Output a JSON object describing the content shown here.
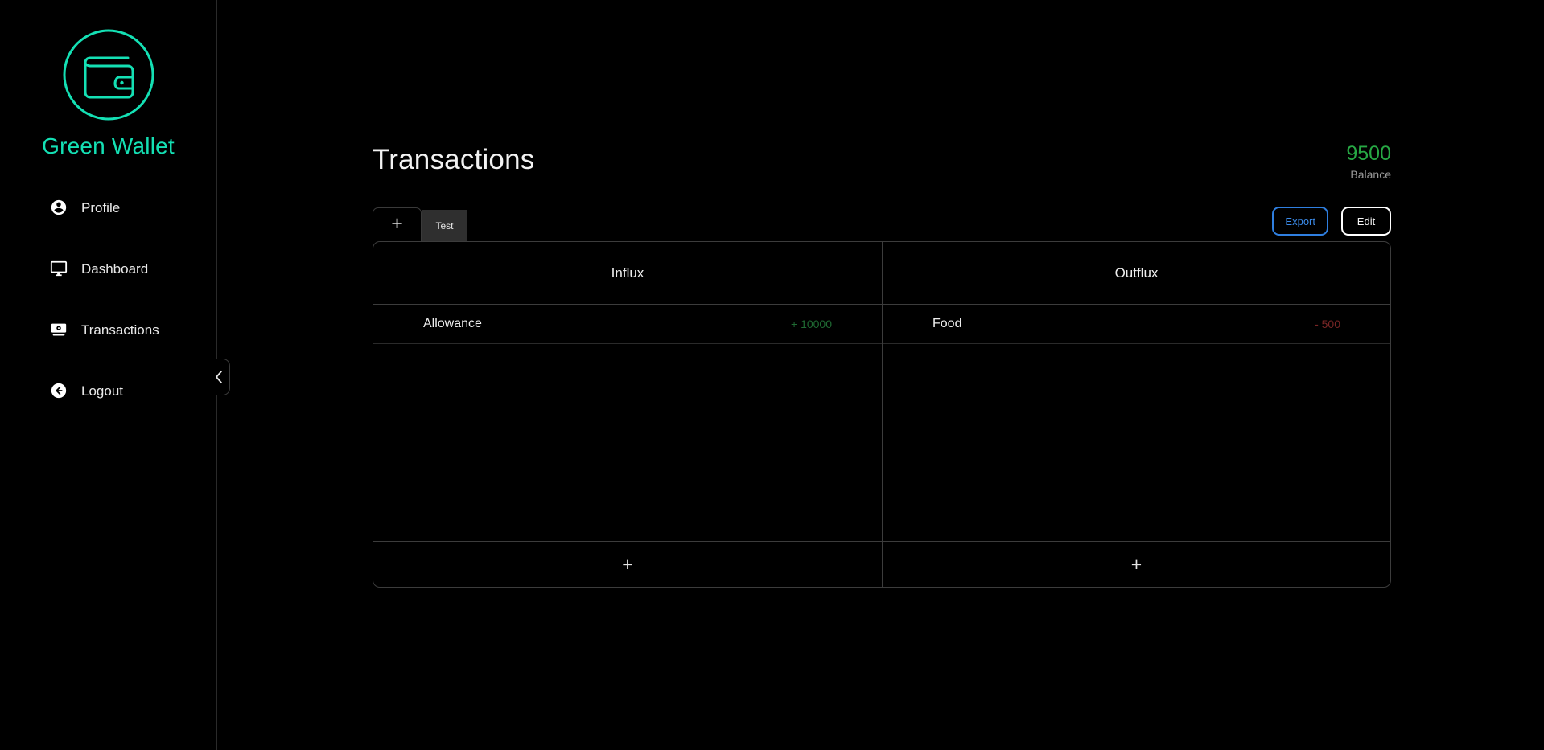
{
  "brand": {
    "name": "Green Wallet",
    "logo_icon": "wallet-icon",
    "accent_color": "#14e0b4"
  },
  "sidebar": {
    "collapse_icon": "chevron-left-icon",
    "items": [
      {
        "label": "Profile",
        "icon": "account-circle-icon"
      },
      {
        "label": "Dashboard",
        "icon": "desktop-monitor-icon"
      },
      {
        "label": "Transactions",
        "icon": "banknote-icon"
      },
      {
        "label": "Logout",
        "icon": "arrow-left-circle-icon"
      }
    ]
  },
  "header": {
    "title": "Transactions",
    "balance_value": "9500",
    "balance_label": "Balance",
    "balance_color": "#27a844"
  },
  "toolbar": {
    "add_tab_label": "+",
    "tabs": [
      {
        "label": "Test",
        "active": true
      }
    ],
    "export_label": "Export",
    "edit_label": "Edit",
    "export_color": "#3b8ae8",
    "edit_color": "#ffffff"
  },
  "table": {
    "columns": [
      {
        "header": "Influx",
        "add_label": "+",
        "rows": [
          {
            "name": "Allowance",
            "amount": "+ 10000",
            "sign": "positive"
          }
        ]
      },
      {
        "header": "Outflux",
        "add_label": "+",
        "rows": [
          {
            "name": "Food",
            "amount": "- 500",
            "sign": "negative"
          }
        ]
      }
    ]
  }
}
